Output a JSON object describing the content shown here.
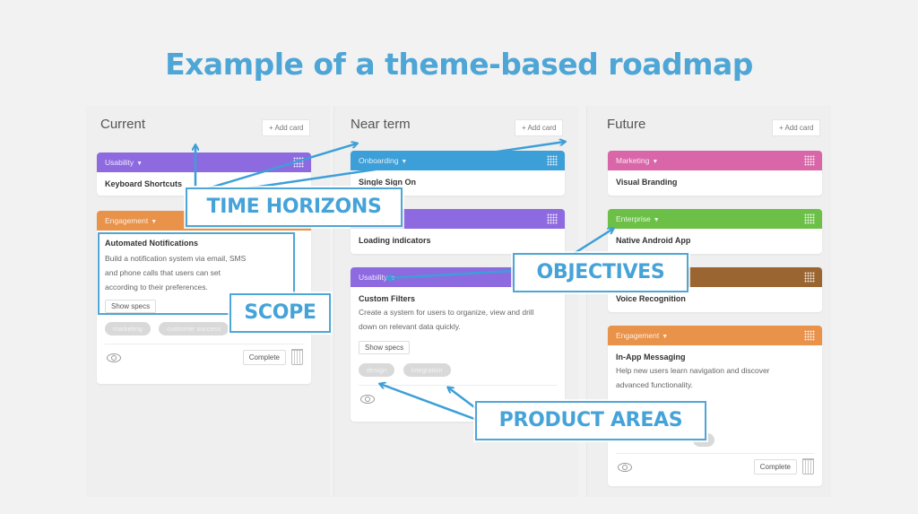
{
  "title": "Example of a theme-based roadmap",
  "colors": {
    "accent": "#4ea6d6",
    "usability": "#8e6ae0",
    "engagement": "#e8924a",
    "onboarding": "#3d9fd8",
    "marketing": "#d966a8",
    "enterprise": "#6cc047",
    "brown": "#9a6531"
  },
  "columns": [
    {
      "title": "Current",
      "add_label": "+ Add card",
      "cards": [
        {
          "theme": "Usability",
          "title": "Keyboard Shortcuts"
        },
        {
          "theme": "Engagement",
          "title": "Automated Notifications",
          "description_lines": [
            "Build a notification system via email, SMS",
            "and phone calls that users can set",
            "according to their preferences."
          ],
          "specs_label": "Show specs",
          "tags": [
            "marketing",
            "customer success"
          ],
          "complete_label": "Complete"
        }
      ]
    },
    {
      "title": "Near term",
      "add_label": "+ Add card",
      "cards": [
        {
          "theme": "Onboarding",
          "title": "Single Sign On"
        },
        {
          "theme": "",
          "title": "Loading indicators"
        },
        {
          "theme": "Usability",
          "title": "Custom Filters",
          "description_lines": [
            "Create a system for users to organize, view and drill",
            "down on relevant data quickly."
          ],
          "specs_label": "Show specs",
          "tags": [
            "design",
            "integration"
          ]
        }
      ]
    },
    {
      "title": "Future",
      "add_label": "+ Add card",
      "cards": [
        {
          "theme": "Marketing",
          "title": "Visual Branding"
        },
        {
          "theme": "Enterprise",
          "title": "Native Android App"
        },
        {
          "theme": "",
          "title": "Voice Recognition"
        },
        {
          "theme": "Engagement",
          "title": "In-App Messaging",
          "description_lines": [
            "Help new users learn navigation and discover",
            "advanced functionality."
          ],
          "complete_label": "Complete"
        }
      ]
    }
  ],
  "callouts": {
    "time_horizons": "TIME HORIZONS",
    "scope": "SCOPE",
    "objectives": "OBJECTIVES",
    "product_areas": "PRODUCT AREAS"
  }
}
